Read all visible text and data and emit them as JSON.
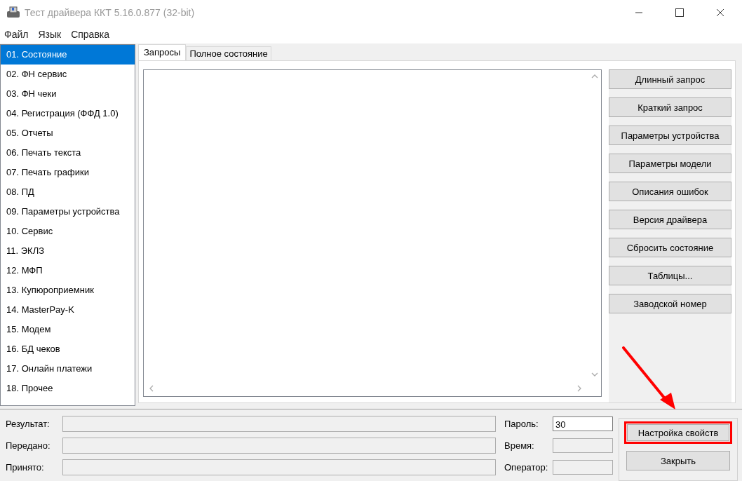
{
  "window": {
    "title": "Тест драйвера ККТ 5.16.0.877 (32-bit)"
  },
  "menu": [
    "Файл",
    "Язык",
    "Справка"
  ],
  "sidebar": {
    "items": [
      {
        "label": "01. Состояние",
        "selected": true
      },
      {
        "label": "02. ФН сервис",
        "selected": false
      },
      {
        "label": "03. ФН чеки",
        "selected": false
      },
      {
        "label": "04. Регистрация (ФФД 1.0)",
        "selected": false
      },
      {
        "label": "05. Отчеты",
        "selected": false
      },
      {
        "label": "06. Печать текста",
        "selected": false
      },
      {
        "label": "07. Печать графики",
        "selected": false
      },
      {
        "label": "08. ПД",
        "selected": false
      },
      {
        "label": "09. Параметры устройства",
        "selected": false
      },
      {
        "label": "10. Сервис",
        "selected": false
      },
      {
        "label": "11. ЭКЛЗ",
        "selected": false
      },
      {
        "label": "12. МФП",
        "selected": false
      },
      {
        "label": "13. Купюроприемник",
        "selected": false
      },
      {
        "label": "14. MasterPay-K",
        "selected": false
      },
      {
        "label": "15. Модем",
        "selected": false
      },
      {
        "label": "16. БД чеков",
        "selected": false
      },
      {
        "label": "17. Онлайн платежи",
        "selected": false
      },
      {
        "label": "18. Прочее",
        "selected": false
      }
    ]
  },
  "tabs": [
    {
      "label": "Запросы",
      "selected": true
    },
    {
      "label": "Полное состояние",
      "selected": false
    }
  ],
  "actions": [
    "Длинный запрос",
    "Краткий запрос",
    "Параметры устройства",
    "Параметры модели",
    "Описания ошибок",
    "Версия драйвера",
    "Сбросить состояние",
    "Таблицы...",
    "Заводской номер"
  ],
  "status_fields": [
    {
      "label": "Результат:"
    },
    {
      "label": "Передано:"
    },
    {
      "label": "Принято:"
    }
  ],
  "side_fields": [
    {
      "label": "Пароль:",
      "value": "30",
      "enabled": true
    },
    {
      "label": "Время:",
      "enabled": false
    },
    {
      "label": "Оператор:",
      "enabled": false
    }
  ],
  "bottom_buttons": [
    {
      "label": "Настройка свойств",
      "highlighted": true
    },
    {
      "label": "Закрыть",
      "highlighted": false
    }
  ]
}
